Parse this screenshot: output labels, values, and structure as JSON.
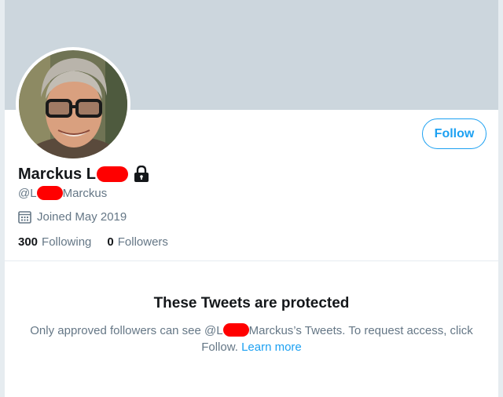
{
  "profile": {
    "name_prefix": "Marckus L",
    "handle_prefix": "@L",
    "handle_suffix": "Marckus",
    "joined": "Joined May 2019",
    "following_count": "300",
    "following_label": "Following",
    "followers_count": "0",
    "followers_label": "Followers"
  },
  "actions": {
    "follow_label": "Follow"
  },
  "protected": {
    "title": "These Tweets are protected",
    "text_prefix": "Only approved followers can see @L",
    "text_suffix": "Marckus’s Tweets. To request access, click Follow. ",
    "learn_more": "Learn more"
  },
  "icons": {
    "lock": "lock-icon",
    "calendar": "calendar-icon"
  },
  "colors": {
    "accent": "#1da1f2",
    "banner": "#ccd6dd",
    "redaction": "#ff0000",
    "secondary_text": "#657786",
    "primary_text": "#14171a"
  }
}
